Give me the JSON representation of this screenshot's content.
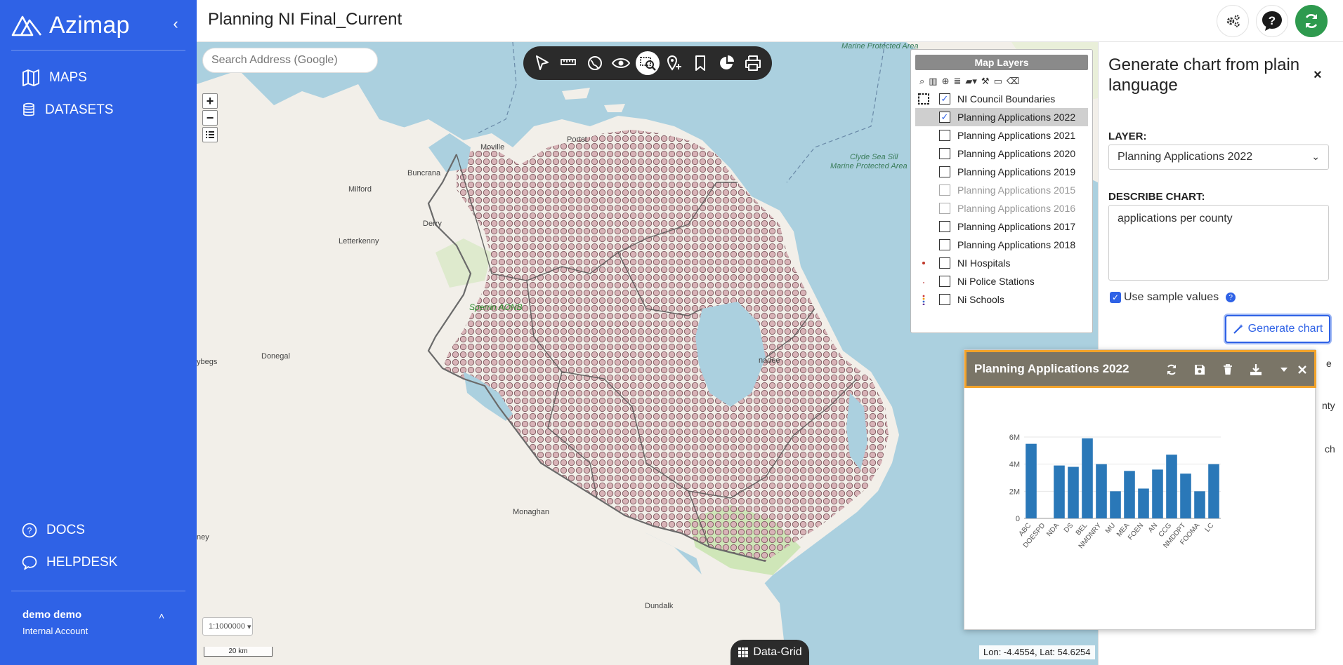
{
  "sidebar": {
    "brand": "Azimap",
    "collapse_glyph": "‹",
    "nav": [
      {
        "label": "MAPS",
        "icon": "map-icon"
      },
      {
        "label": "DATASETS",
        "icon": "database-icon"
      }
    ],
    "bottom_nav": [
      {
        "label": "DOCS",
        "icon": "help-circle-icon"
      },
      {
        "label": "HELPDESK",
        "icon": "chat-icon"
      }
    ],
    "user": {
      "name": "demo demo",
      "account": "Internal Account",
      "caret": "˄"
    }
  },
  "topbar": {
    "title": "Planning NI Final_Current",
    "icons": [
      "settings-icon",
      "help-icon",
      "refresh-icon"
    ]
  },
  "map": {
    "search_placeholder": "Search Address (Google)",
    "zoom_in": "+",
    "zoom_out": "−",
    "tools": [
      "select-icon",
      "measure-icon",
      "layers-style-icon",
      "visibility-icon",
      "search-zoom-icon",
      "pin-icon",
      "bookmark-icon",
      "pie-chart-icon",
      "print-icon"
    ],
    "labels": {
      "moville": "Moville",
      "buncrana": "Buncrana",
      "milford": "Milford",
      "derry": "Derry",
      "letterkenny": "Letterkenny",
      "donegal": "Donegal",
      "monaghan": "Monaghan",
      "dundalk": "Dundalk",
      "portstewart": "Portst",
      "sperrin": "Sperrin AONB",
      "mpa_top": "Marine Protected Area",
      "clyde1": "Clyde Sea Sill",
      "clyde2": "Marine Protected Area",
      "ybegs": "ybegs",
      "ney": "ney",
      "nadee": "nadee"
    },
    "scale_select": "1:1000000",
    "scale_bar": "20 km",
    "datagrid": "Data-Grid",
    "coords": "Lon: -4.4554, Lat: 54.6254"
  },
  "layers_panel": {
    "title": "Map Layers",
    "layers": [
      {
        "name": "NI Council Boundaries",
        "checked": true,
        "state": "normal"
      },
      {
        "name": "Planning Applications 2022",
        "checked": true,
        "state": "selected"
      },
      {
        "name": "Planning Applications 2021",
        "checked": false,
        "state": "normal"
      },
      {
        "name": "Planning Applications 2020",
        "checked": false,
        "state": "normal"
      },
      {
        "name": "Planning Applications 2019",
        "checked": false,
        "state": "normal"
      },
      {
        "name": "Planning Applications 2015",
        "checked": false,
        "state": "disabled"
      },
      {
        "name": "Planning Applications 2016",
        "checked": false,
        "state": "disabled"
      },
      {
        "name": "Planning Applications 2017",
        "checked": false,
        "state": "normal"
      },
      {
        "name": "Planning Applications 2018",
        "checked": false,
        "state": "normal"
      },
      {
        "name": "NI Hospitals",
        "checked": false,
        "state": "normal"
      },
      {
        "name": "Ni Police Stations",
        "checked": false,
        "state": "normal"
      },
      {
        "name": "Ni Schools",
        "checked": false,
        "state": "normal"
      }
    ]
  },
  "right_panel": {
    "title": "Generate chart from plain language",
    "close": "×",
    "layer_label": "LAYER:",
    "layer_value": "Planning Applications 2022",
    "describe_label": "DESCRIBE CHART:",
    "describe_value": "applications per county",
    "sample_label": "Use sample values",
    "generate_label": "Generate chart",
    "peek": {
      "a": "e",
      "b": "nty",
      "c": "ch"
    }
  },
  "chart_popup": {
    "title": "Planning Applications 2022"
  },
  "colors": {
    "sidebar": "#2f62e6",
    "bar": "#2a78b8",
    "highlight": "#f2a32a",
    "accent": "#2f62e6",
    "refresh": "#2e9a4e"
  },
  "chart_data": {
    "type": "bar",
    "categories": [
      "ABC",
      "DOESPD",
      "NDA",
      "DS",
      "BEL",
      "NMDNRY",
      "MU",
      "MEA",
      "FOEN",
      "AN",
      "CCG",
      "NMDDPT",
      "FOOMA",
      "LC"
    ],
    "values": [
      5.5,
      0,
      3.9,
      3.8,
      5.9,
      4.0,
      2.0,
      3.5,
      2.2,
      3.6,
      4.7,
      3.3,
      2.0,
      4.0
    ],
    "yticks": [
      "0",
      "2M",
      "4M",
      "6M"
    ],
    "ylim": [
      0,
      6
    ],
    "title": "",
    "xlabel": "",
    "ylabel": ""
  }
}
